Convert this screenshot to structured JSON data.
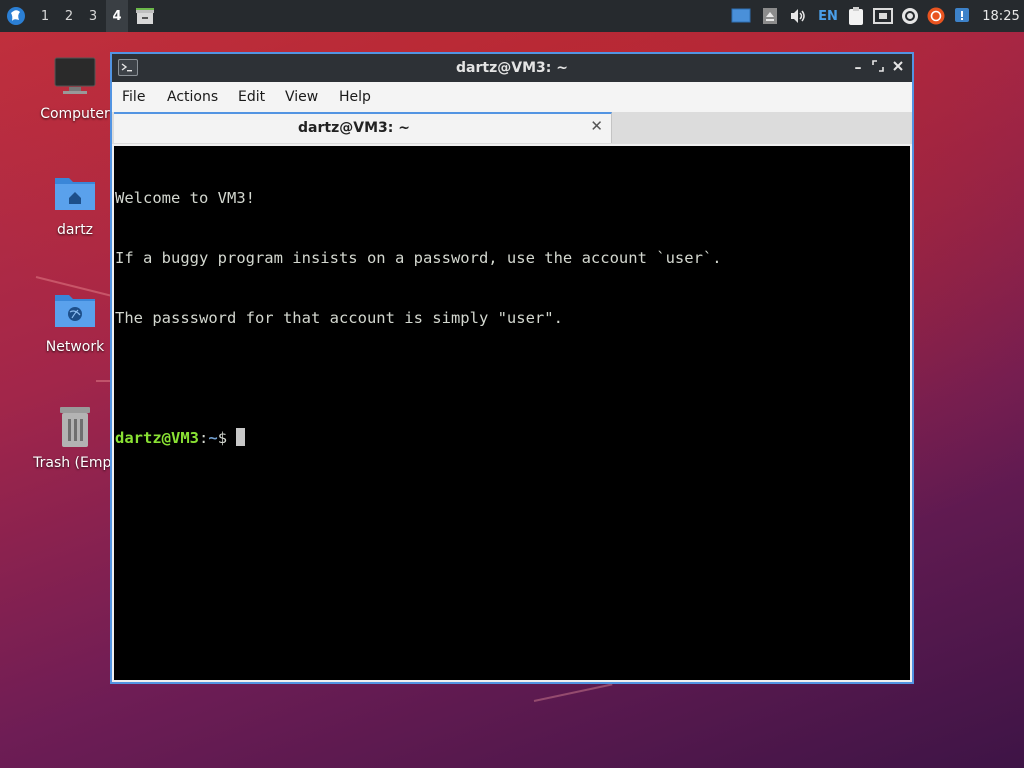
{
  "panel": {
    "workspaces": [
      "1",
      "2",
      "3",
      "4"
    ],
    "active_workspace": "4",
    "keyboard_layout": "EN",
    "clock": "18:25",
    "tray_icons": [
      "monitor-icon",
      "eject-icon",
      "volume-icon",
      "keyboard-layout",
      "clipboard-icon",
      "network-wired-icon",
      "sync-icon",
      "software-updater-icon",
      "info-notification-icon"
    ]
  },
  "desktop": {
    "icons": [
      {
        "label": "Computer",
        "icon": "computer-icon"
      },
      {
        "label": "dartz",
        "icon": "home-folder-icon"
      },
      {
        "label": "Network",
        "icon": "network-folder-icon"
      },
      {
        "label": "Trash (Empt",
        "icon": "trash-icon"
      }
    ]
  },
  "window": {
    "title": "dartz@VM3: ~",
    "menu": [
      "File",
      "Actions",
      "Edit",
      "View",
      "Help"
    ],
    "tab_label": "dartz@VM3: ~",
    "terminal": {
      "lines": [
        "Welcome to VM3!",
        "If a buggy program insists on a password, use the account `user`.",
        "The passsword for that account is simply \"user\"."
      ],
      "prompt_user": "dartz@VM3",
      "prompt_sep": ":",
      "prompt_path": "~",
      "prompt_symbol": "$ "
    }
  },
  "colors": {
    "accent": "#5294e2",
    "prompt_user": "#8ae234",
    "prompt_path": "#729fcf",
    "panel_bg": "#262a2e"
  }
}
